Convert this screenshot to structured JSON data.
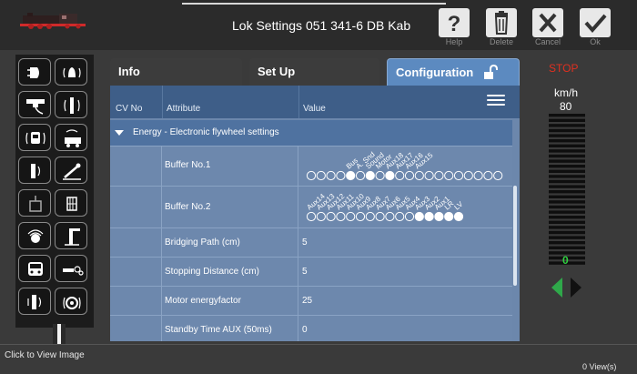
{
  "header": {
    "title": "Lok Settings 051 341-6 DB Kab",
    "buttons": [
      {
        "glyph": "?",
        "label": "Help"
      },
      {
        "glyph": "trash",
        "label": "Delete"
      },
      {
        "glyph": "x",
        "label": "Cancel"
      },
      {
        "glyph": "check",
        "label": "Ok"
      }
    ]
  },
  "tabs": {
    "info": "Info",
    "setup": "Set Up",
    "config": "Configuration"
  },
  "table": {
    "columns": {
      "cv": "CV No",
      "attribute": "Attribute",
      "value": "Value"
    },
    "group": "Energy - Electronic flywheel settings",
    "rows": [
      {
        "attribute": "Buffer No.1",
        "value": ""
      },
      {
        "attribute": "Buffer No.2",
        "value": ""
      },
      {
        "attribute": "Bridging Path (cm)",
        "value": "5"
      },
      {
        "attribute": "Stopping Distance (cm)",
        "value": "5"
      },
      {
        "attribute": "Motor energyfactor",
        "value": "25"
      },
      {
        "attribute": "Standby Time AUX (50ms)",
        "value": "0"
      }
    ],
    "buffer1_bits": {
      "labels": [
        "Bus",
        "A. Snd",
        "Sound",
        "Motor",
        "Aux18",
        "Aux17",
        "Aux16",
        "Aux15"
      ],
      "states": [
        0,
        0,
        0,
        0,
        1,
        0,
        1,
        0,
        1,
        0,
        0,
        0,
        0,
        0,
        0,
        0,
        0,
        0,
        0,
        0
      ]
    },
    "buffer2_bits": {
      "labels": [
        "Aux14",
        "Aux13",
        "Aux12",
        "Aux11",
        "Aux10",
        "Aux9",
        "Aux8",
        "Aux7",
        "Aux6",
        "Aux5",
        "Aux4",
        "Aux3",
        "Aux2",
        "Aux1",
        "LR",
        "LV"
      ],
      "states": [
        0,
        0,
        0,
        0,
        0,
        0,
        0,
        0,
        0,
        0,
        0,
        1,
        1,
        1,
        1,
        1
      ]
    }
  },
  "right_panel": {
    "stop": "STOP",
    "unit": "km/h",
    "max_speed": "80",
    "current_speed": "0",
    "colors": {
      "stop": "#e03020",
      "forward": "#2fa84a"
    }
  },
  "footer": {
    "caption": "Click to View Image",
    "views": "0 View(s)"
  }
}
